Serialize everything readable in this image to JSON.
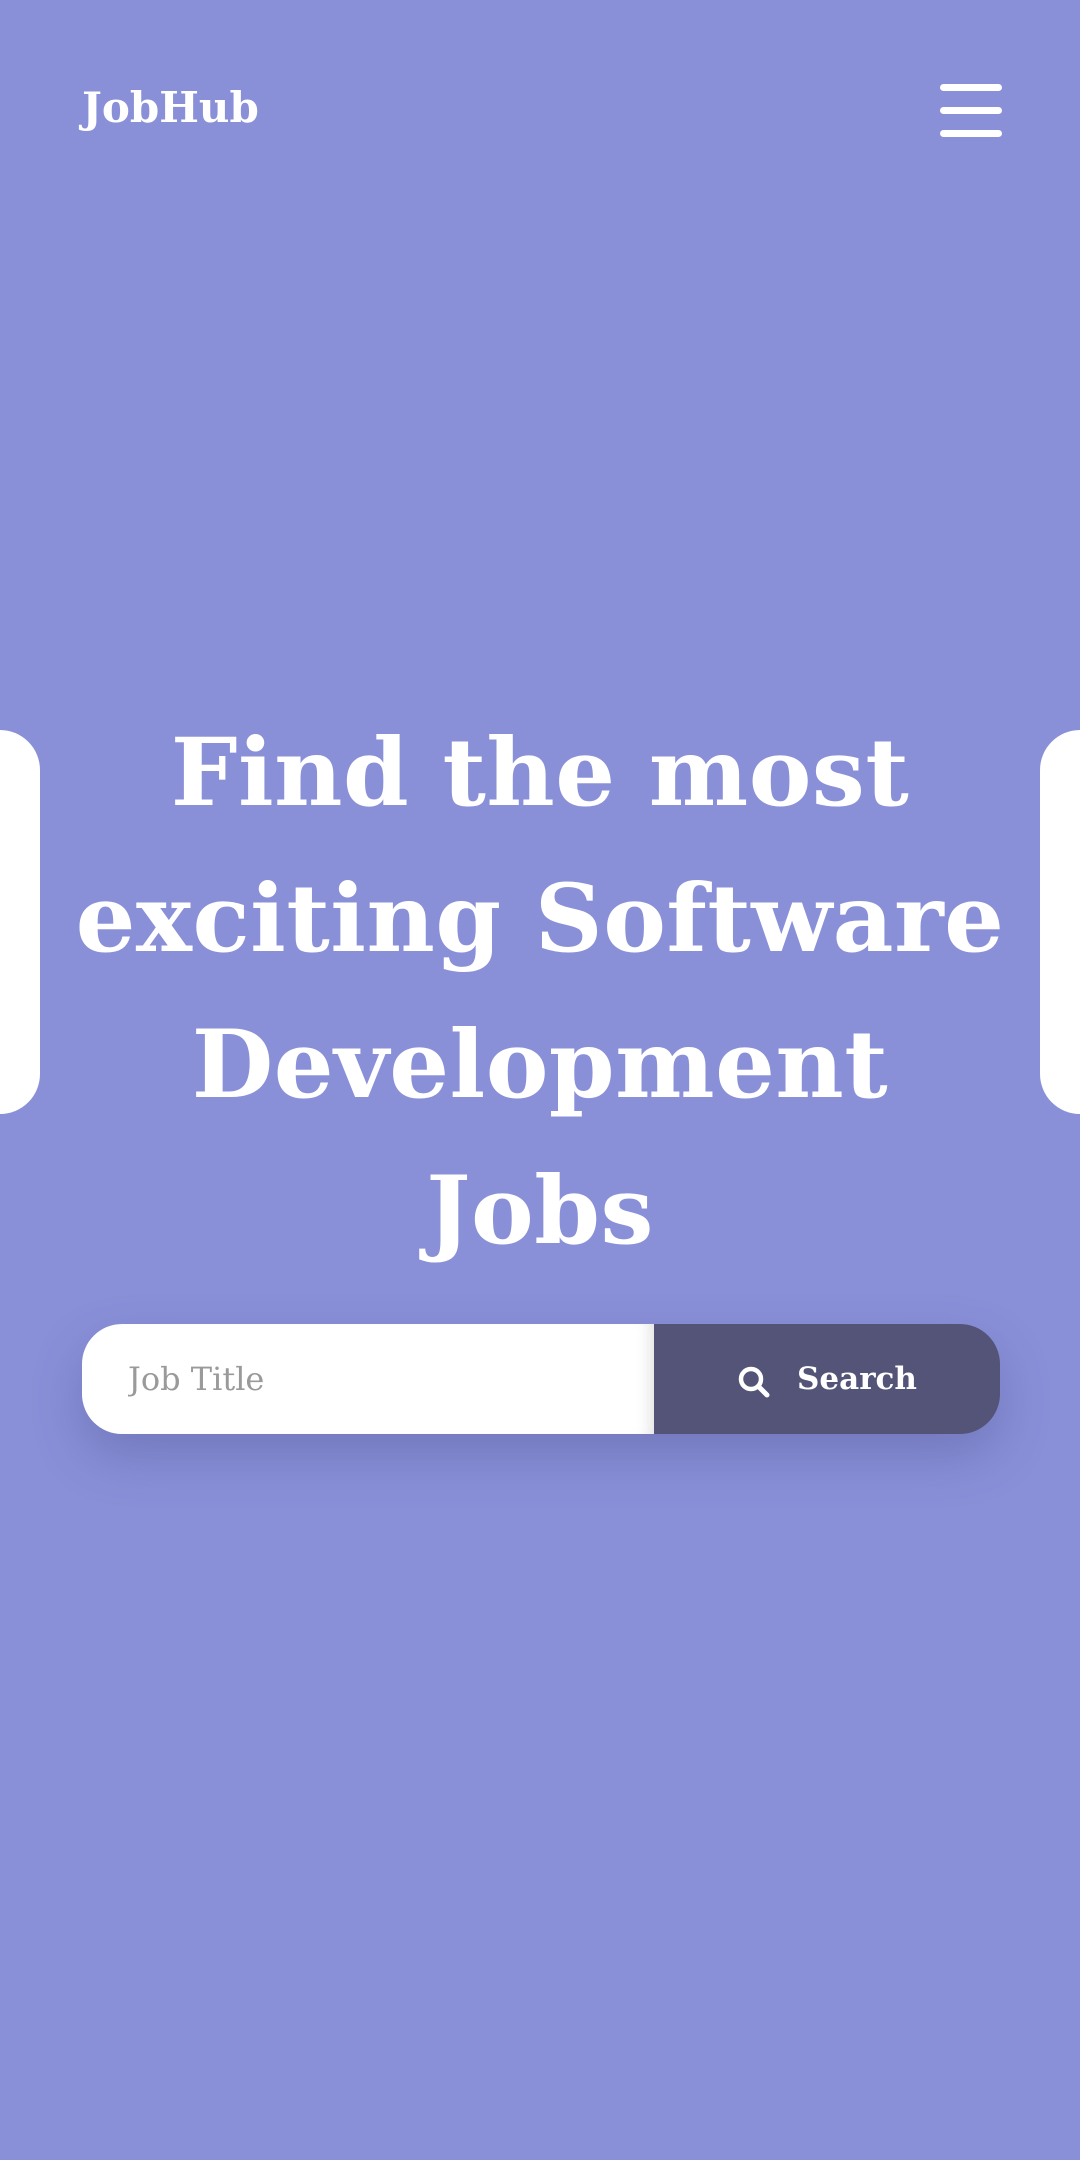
{
  "header": {
    "logo": "JobHub",
    "menu_icon": "hamburger-menu-icon"
  },
  "hero": {
    "title": "Find the most exciting Software Development Jobs"
  },
  "search": {
    "placeholder": "Job Title",
    "value": "",
    "button_label": "Search",
    "button_icon": "search-icon"
  },
  "colors": {
    "background": "#8990d8",
    "button": "#535478",
    "text": "#ffffff",
    "input_background": "#ffffff",
    "placeholder": "#9a9a9a"
  }
}
